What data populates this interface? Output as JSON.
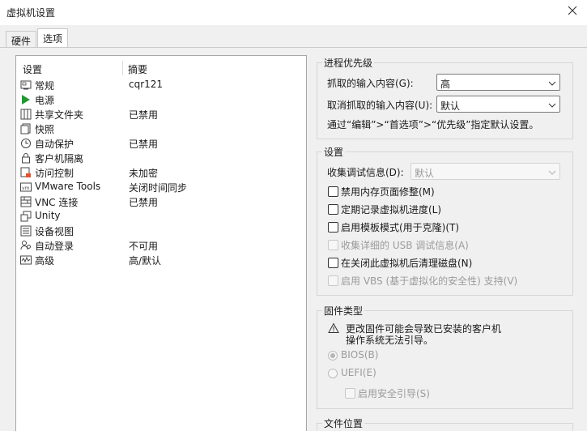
{
  "window": {
    "title": "虚拟机设置"
  },
  "tabs": [
    {
      "label": "硬件"
    },
    {
      "label": "选项"
    }
  ],
  "list": {
    "headers": {
      "setting": "设置",
      "summary": "摘要"
    },
    "items": [
      {
        "name": "常规",
        "summary": "cqr121",
        "icon": "general-icon"
      },
      {
        "name": "电源",
        "summary": "",
        "icon": "power-play-icon"
      },
      {
        "name": "共享文件夹",
        "summary": "已禁用",
        "icon": "shared-folders-icon"
      },
      {
        "name": "快照",
        "summary": "",
        "icon": "snapshot-icon"
      },
      {
        "name": "自动保护",
        "summary": "已禁用",
        "icon": "autoprotect-clock-icon"
      },
      {
        "name": "客户机隔离",
        "summary": "",
        "icon": "lock-icon"
      },
      {
        "name": "访问控制",
        "summary": "未加密",
        "icon": "access-control-icon"
      },
      {
        "name": "VMware Tools",
        "summary": "关闭时间同步",
        "icon": "vmware-tools-icon"
      },
      {
        "name": "VNC 连接",
        "summary": "已禁用",
        "icon": "vnc-icon"
      },
      {
        "name": "Unity",
        "summary": "",
        "icon": "unity-icon"
      },
      {
        "name": "设备视图",
        "summary": "",
        "icon": "device-view-icon"
      },
      {
        "name": "自动登录",
        "summary": "不可用",
        "icon": "autologon-users-icon"
      },
      {
        "name": "高级",
        "summary": "高/默认",
        "icon": "advanced-icon"
      }
    ]
  },
  "process_priority": {
    "legend": "进程优先级",
    "grabbed_label": "抓取的输入内容(G):",
    "grabbed_value": "高",
    "ungrabbed_label": "取消抓取的输入内容(U):",
    "ungrabbed_value": "默认",
    "note": "通过“编辑”>“首选项”>“优先级”指定默认设置。"
  },
  "settings": {
    "legend": "设置",
    "debug_label": "收集调试信息(D):",
    "debug_value": "默认",
    "checkboxes": [
      {
        "label": "禁用内存页面修整(M)",
        "checked": false,
        "disabled": false
      },
      {
        "label": "定期记录虚拟机进度(L)",
        "checked": false,
        "disabled": false
      },
      {
        "label": "启用模板模式(用于克隆)(T)",
        "checked": false,
        "disabled": false
      },
      {
        "label": "收集详细的 USB 调试信息(A)",
        "checked": false,
        "disabled": true
      },
      {
        "label": "在关闭此虚拟机后清理磁盘(N)",
        "checked": false,
        "disabled": false
      },
      {
        "label": "启用 VBS (基于虚拟化的安全性) 支持(V)",
        "checked": false,
        "disabled": true
      }
    ]
  },
  "firmware": {
    "legend": "固件类型",
    "warning_line1": "更改固件可能会导致已安装的客户机",
    "warning_line2": "操作系统无法引导。",
    "bios_label": "BIOS(B)",
    "uefi_label": "UEFI(E)",
    "secure_boot_label": "启用安全引导(S)",
    "selected": "BIOS"
  },
  "file_location": {
    "legend": "文件位置"
  }
}
